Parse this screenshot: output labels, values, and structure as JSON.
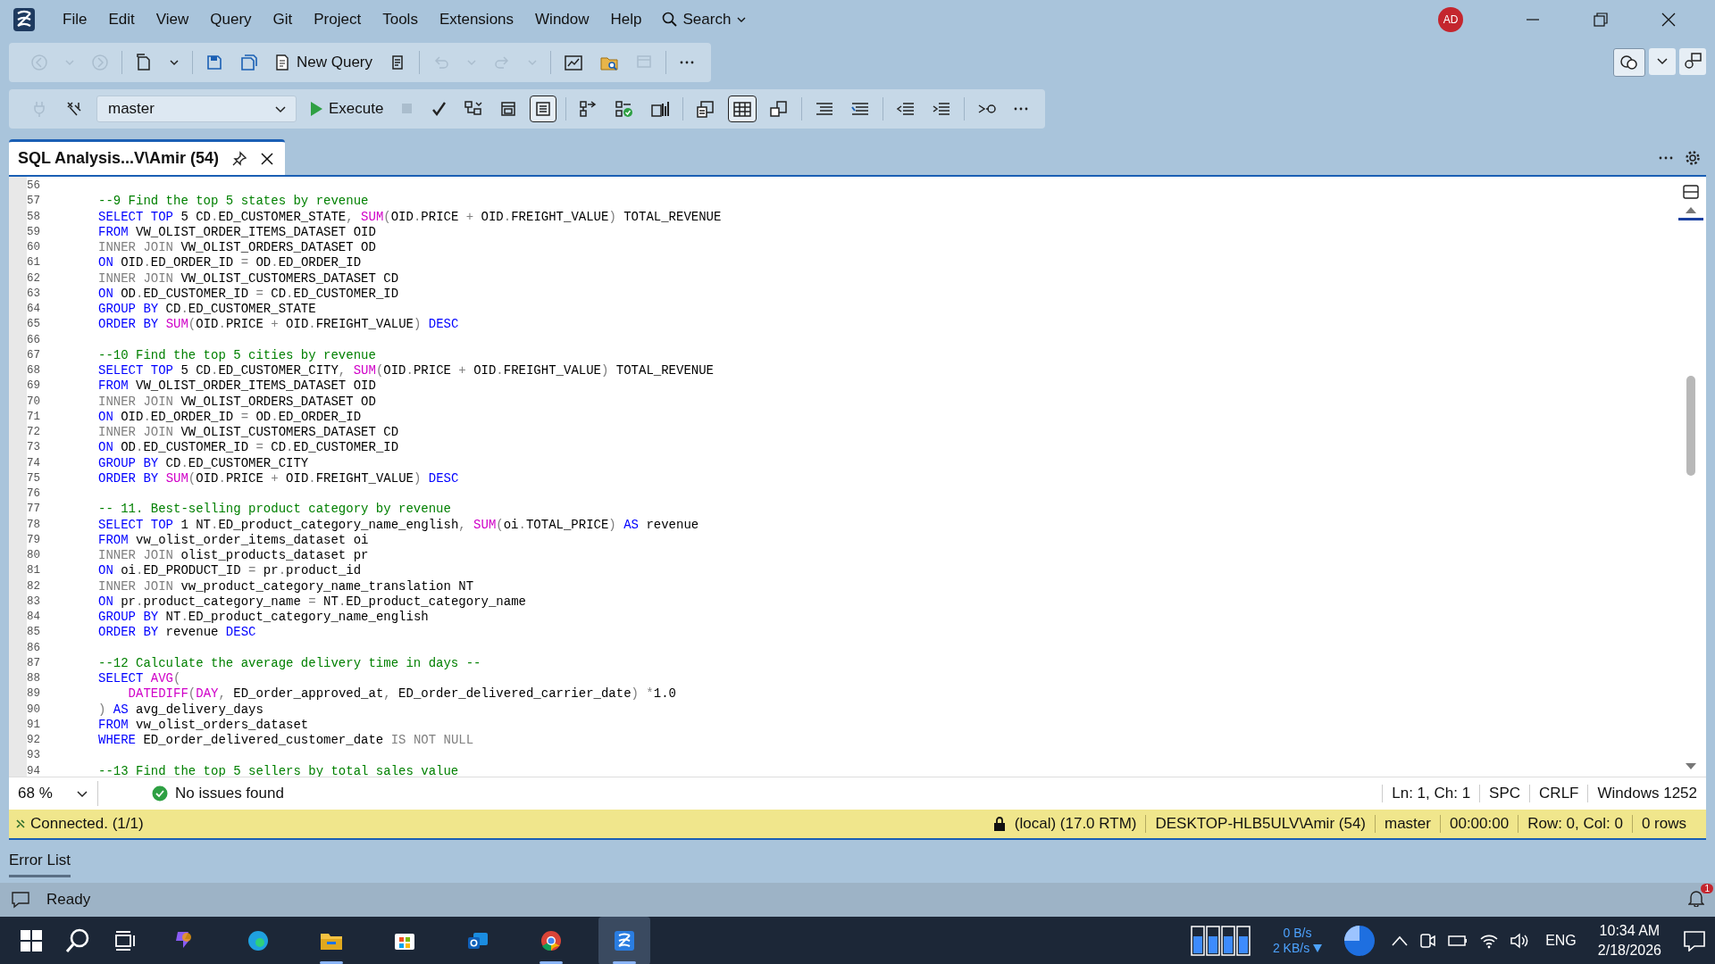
{
  "menu": [
    "File",
    "Edit",
    "View",
    "Query",
    "Git",
    "Project",
    "Tools",
    "Extensions",
    "Window",
    "Help"
  ],
  "search": "Search",
  "avatar": "AD",
  "toolbar_1": {
    "buttons_before": [
      {
        "disabled": true
      },
      {
        "disabled": true
      },
      {
        "disabled": true
      },
      {
        "disabled": false
      },
      {
        "disabled": false
      },
      {
        "disabled": false
      },
      {
        "disabled": false
      }
    ],
    "new_query": "New Query",
    "buttons_after": [
      {
        "disabled": false
      },
      {
        "disabled": true
      },
      {
        "disabled": true
      },
      {
        "disabled": true
      },
      {
        "disabled": true
      },
      {
        "disabled": false
      },
      {
        "disabled": false
      },
      {
        "disabled": true
      },
      {
        "disabled": false
      }
    ]
  },
  "toolbar_2": {
    "buttons_before": [
      {
        "disabled": true
      },
      {
        "disabled": false
      }
    ],
    "database": "master",
    "execute": "Execute",
    "buttons_after": [
      {
        "disabled": true,
        "selected": false
      },
      {
        "disabled": false,
        "selected": false
      },
      {
        "disabled": false,
        "selected": false
      },
      {
        "disabled": false,
        "selected": false
      },
      {
        "disabled": false,
        "selected": true
      },
      {
        "disabled": false,
        "selected": false
      },
      {
        "disabled": false,
        "selected": false
      },
      {
        "disabled": false,
        "selected": false
      },
      {
        "disabled": false,
        "selected": false
      },
      {
        "disabled": false,
        "selected": true
      },
      {
        "disabled": false,
        "selected": false
      },
      {
        "disabled": false,
        "selected": false
      },
      {
        "disabled": false,
        "selected": false
      },
      {
        "disabled": false,
        "selected": false
      },
      {
        "disabled": false,
        "selected": false
      },
      {
        "disabled": false,
        "selected": false
      },
      {
        "disabled": false,
        "selected": false
      }
    ]
  },
  "tab": {
    "title": "SQL Analysis...V\\Amir (54)",
    "selected": true
  },
  "lines": [
    {
      "n": "56"
    },
    {
      "n": "57",
      "t": [
        {
          "kind": "comment",
          "text": "--9 Find the top 5 states by revenue"
        }
      ]
    },
    {
      "n": "58",
      "t": [
        {
          "kind": "keyword",
          "text": "SELECT TOP"
        },
        {
          "kind": "plain",
          "text": " 5 CD"
        },
        {
          "kind": "gray",
          "text": "."
        },
        {
          "kind": "plain",
          "text": "ED_CUSTOMER_STATE"
        },
        {
          "kind": "gray",
          "text": ", "
        },
        {
          "kind": "function",
          "text": "SUM"
        },
        {
          "kind": "gray",
          "text": "("
        },
        {
          "kind": "plain",
          "text": "OID"
        },
        {
          "kind": "gray",
          "text": "."
        },
        {
          "kind": "plain",
          "text": "PRICE "
        },
        {
          "kind": "gray",
          "text": "+"
        },
        {
          "kind": "plain",
          "text": " OID"
        },
        {
          "kind": "gray",
          "text": "."
        },
        {
          "kind": "plain",
          "text": "FREIGHT_VALUE"
        },
        {
          "kind": "gray",
          "text": ")"
        },
        {
          "kind": "plain",
          "text": " TOTAL_REVENUE"
        }
      ]
    },
    {
      "n": "59",
      "t": [
        {
          "kind": "keyword",
          "text": "FROM"
        },
        {
          "kind": "plain",
          "text": " VW_OLIST_ORDER_ITEMS_DATASET OID"
        }
      ]
    },
    {
      "n": "60",
      "t": [
        {
          "kind": "gray",
          "text": "INNER JOIN"
        },
        {
          "kind": "plain",
          "text": " VW_OLIST_ORDERS_DATASET OD"
        }
      ]
    },
    {
      "n": "61",
      "t": [
        {
          "kind": "keyword",
          "text": "ON"
        },
        {
          "kind": "plain",
          "text": " OID"
        },
        {
          "kind": "gray",
          "text": "."
        },
        {
          "kind": "plain",
          "text": "ED_ORDER_ID "
        },
        {
          "kind": "gray",
          "text": "="
        },
        {
          "kind": "plain",
          "text": " OD"
        },
        {
          "kind": "gray",
          "text": "."
        },
        {
          "kind": "plain",
          "text": "ED_ORDER_ID"
        }
      ]
    },
    {
      "n": "62",
      "t": [
        {
          "kind": "gray",
          "text": "INNER JOIN"
        },
        {
          "kind": "plain",
          "text": " VW_OLIST_CUSTOMERS_DATASET CD"
        }
      ]
    },
    {
      "n": "63",
      "t": [
        {
          "kind": "keyword",
          "text": "ON"
        },
        {
          "kind": "plain",
          "text": " OD"
        },
        {
          "kind": "gray",
          "text": "."
        },
        {
          "kind": "plain",
          "text": "ED_CUSTOMER_ID "
        },
        {
          "kind": "gray",
          "text": "="
        },
        {
          "kind": "plain",
          "text": " CD"
        },
        {
          "kind": "gray",
          "text": "."
        },
        {
          "kind": "plain",
          "text": "ED_CUSTOMER_ID"
        }
      ]
    },
    {
      "n": "64",
      "t": [
        {
          "kind": "keyword",
          "text": "GROUP BY"
        },
        {
          "kind": "plain",
          "text": " CD"
        },
        {
          "kind": "gray",
          "text": "."
        },
        {
          "kind": "plain",
          "text": "ED_CUSTOMER_STATE"
        }
      ]
    },
    {
      "n": "65",
      "t": [
        {
          "kind": "keyword",
          "text": "ORDER BY "
        },
        {
          "kind": "function",
          "text": "SUM"
        },
        {
          "kind": "gray",
          "text": "("
        },
        {
          "kind": "plain",
          "text": "OID"
        },
        {
          "kind": "gray",
          "text": "."
        },
        {
          "kind": "plain",
          "text": "PRICE "
        },
        {
          "kind": "gray",
          "text": "+"
        },
        {
          "kind": "plain",
          "text": " OID"
        },
        {
          "kind": "gray",
          "text": "."
        },
        {
          "kind": "plain",
          "text": "FREIGHT_VALUE"
        },
        {
          "kind": "gray",
          "text": ") "
        },
        {
          "kind": "keyword",
          "text": "DESC"
        }
      ]
    },
    {
      "n": "66"
    },
    {
      "n": "67",
      "t": [
        {
          "kind": "comment",
          "text": "--10 Find the top 5 cities by revenue"
        }
      ]
    },
    {
      "n": "68",
      "t": [
        {
          "kind": "keyword",
          "text": "SELECT TOP"
        },
        {
          "kind": "plain",
          "text": " 5 CD"
        },
        {
          "kind": "gray",
          "text": "."
        },
        {
          "kind": "plain",
          "text": "ED_CUSTOMER_CITY"
        },
        {
          "kind": "gray",
          "text": ", "
        },
        {
          "kind": "function",
          "text": "SUM"
        },
        {
          "kind": "gray",
          "text": "("
        },
        {
          "kind": "plain",
          "text": "OID"
        },
        {
          "kind": "gray",
          "text": "."
        },
        {
          "kind": "plain",
          "text": "PRICE "
        },
        {
          "kind": "gray",
          "text": "+"
        },
        {
          "kind": "plain",
          "text": " OID"
        },
        {
          "kind": "gray",
          "text": "."
        },
        {
          "kind": "plain",
          "text": "FREIGHT_VALUE"
        },
        {
          "kind": "gray",
          "text": ")"
        },
        {
          "kind": "plain",
          "text": " TOTAL_REVENUE"
        }
      ]
    },
    {
      "n": "69",
      "t": [
        {
          "kind": "keyword",
          "text": "FROM"
        },
        {
          "kind": "plain",
          "text": " VW_OLIST_ORDER_ITEMS_DATASET OID"
        }
      ]
    },
    {
      "n": "70",
      "t": [
        {
          "kind": "gray",
          "text": "INNER JOIN"
        },
        {
          "kind": "plain",
          "text": " VW_OLIST_ORDERS_DATASET OD"
        }
      ]
    },
    {
      "n": "71",
      "t": [
        {
          "kind": "keyword",
          "text": "ON"
        },
        {
          "kind": "plain",
          "text": " OID"
        },
        {
          "kind": "gray",
          "text": "."
        },
        {
          "kind": "plain",
          "text": "ED_ORDER_ID "
        },
        {
          "kind": "gray",
          "text": "="
        },
        {
          "kind": "plain",
          "text": " OD"
        },
        {
          "kind": "gray",
          "text": "."
        },
        {
          "kind": "plain",
          "text": "ED_ORDER_ID"
        }
      ]
    },
    {
      "n": "72",
      "t": [
        {
          "kind": "gray",
          "text": "INNER JOIN"
        },
        {
          "kind": "plain",
          "text": " VW_OLIST_CUSTOMERS_DATASET CD"
        }
      ]
    },
    {
      "n": "73",
      "t": [
        {
          "kind": "keyword",
          "text": "ON"
        },
        {
          "kind": "plain",
          "text": " OD"
        },
        {
          "kind": "gray",
          "text": "."
        },
        {
          "kind": "plain",
          "text": "ED_CUSTOMER_ID "
        },
        {
          "kind": "gray",
          "text": "="
        },
        {
          "kind": "plain",
          "text": " CD"
        },
        {
          "kind": "gray",
          "text": "."
        },
        {
          "kind": "plain",
          "text": "ED_CUSTOMER_ID"
        }
      ]
    },
    {
      "n": "74",
      "t": [
        {
          "kind": "keyword",
          "text": "GROUP BY"
        },
        {
          "kind": "plain",
          "text": " CD"
        },
        {
          "kind": "gray",
          "text": "."
        },
        {
          "kind": "plain",
          "text": "ED_CUSTOMER_CITY"
        }
      ]
    },
    {
      "n": "75",
      "t": [
        {
          "kind": "keyword",
          "text": "ORDER BY "
        },
        {
          "kind": "function",
          "text": "SUM"
        },
        {
          "kind": "gray",
          "text": "("
        },
        {
          "kind": "plain",
          "text": "OID"
        },
        {
          "kind": "gray",
          "text": "."
        },
        {
          "kind": "plain",
          "text": "PRICE "
        },
        {
          "kind": "gray",
          "text": "+"
        },
        {
          "kind": "plain",
          "text": " OID"
        },
        {
          "kind": "gray",
          "text": "."
        },
        {
          "kind": "plain",
          "text": "FREIGHT_VALUE"
        },
        {
          "kind": "gray",
          "text": ") "
        },
        {
          "kind": "keyword",
          "text": "DESC"
        }
      ]
    },
    {
      "n": "76"
    },
    {
      "n": "77",
      "t": [
        {
          "kind": "comment",
          "text": "-- 11. Best-selling product category by revenue"
        }
      ]
    },
    {
      "n": "78",
      "t": [
        {
          "kind": "keyword",
          "text": "SELECT TOP"
        },
        {
          "kind": "plain",
          "text": " 1 NT"
        },
        {
          "kind": "gray",
          "text": "."
        },
        {
          "kind": "plain",
          "text": "ED_product_category_name_english"
        },
        {
          "kind": "gray",
          "text": ", "
        },
        {
          "kind": "function",
          "text": "SUM"
        },
        {
          "kind": "gray",
          "text": "("
        },
        {
          "kind": "plain",
          "text": "oi"
        },
        {
          "kind": "gray",
          "text": "."
        },
        {
          "kind": "plain",
          "text": "TOTAL_PRICE"
        },
        {
          "kind": "gray",
          "text": ") "
        },
        {
          "kind": "keyword",
          "text": "AS"
        },
        {
          "kind": "plain",
          "text": " revenue"
        }
      ]
    },
    {
      "n": "79",
      "t": [
        {
          "kind": "keyword",
          "text": "FROM"
        },
        {
          "kind": "plain",
          "text": " vw_olist_order_items_dataset oi"
        }
      ]
    },
    {
      "n": "80",
      "t": [
        {
          "kind": "gray",
          "text": "INNER JOIN"
        },
        {
          "kind": "plain",
          "text": " olist_products_dataset pr"
        }
      ]
    },
    {
      "n": "81",
      "t": [
        {
          "kind": "keyword",
          "text": "ON"
        },
        {
          "kind": "plain",
          "text": " oi"
        },
        {
          "kind": "gray",
          "text": "."
        },
        {
          "kind": "plain",
          "text": "ED_PRODUCT_ID "
        },
        {
          "kind": "gray",
          "text": "="
        },
        {
          "kind": "plain",
          "text": " pr"
        },
        {
          "kind": "gray",
          "text": "."
        },
        {
          "kind": "plain",
          "text": "product_id"
        }
      ]
    },
    {
      "n": "82",
      "t": [
        {
          "kind": "gray",
          "text": "INNER JOIN"
        },
        {
          "kind": "plain",
          "text": " vw_product_category_name_translation NT"
        }
      ]
    },
    {
      "n": "83",
      "t": [
        {
          "kind": "keyword",
          "text": "ON"
        },
        {
          "kind": "plain",
          "text": " pr"
        },
        {
          "kind": "gray",
          "text": "."
        },
        {
          "kind": "plain",
          "text": "product_category_name "
        },
        {
          "kind": "gray",
          "text": "="
        },
        {
          "kind": "plain",
          "text": " NT"
        },
        {
          "kind": "gray",
          "text": "."
        },
        {
          "kind": "plain",
          "text": "ED_product_category_name"
        }
      ]
    },
    {
      "n": "84",
      "t": [
        {
          "kind": "keyword",
          "text": "GROUP BY"
        },
        {
          "kind": "plain",
          "text": " NT"
        },
        {
          "kind": "gray",
          "text": "."
        },
        {
          "kind": "plain",
          "text": "ED_product_category_name_english"
        }
      ]
    },
    {
      "n": "85",
      "t": [
        {
          "kind": "keyword",
          "text": "ORDER BY"
        },
        {
          "kind": "plain",
          "text": " revenue "
        },
        {
          "kind": "keyword",
          "text": "DESC"
        }
      ]
    },
    {
      "n": "86"
    },
    {
      "n": "87",
      "t": [
        {
          "kind": "comment",
          "text": "--12 Calculate the average delivery time in days --"
        }
      ]
    },
    {
      "n": "88",
      "t": [
        {
          "kind": "keyword",
          "text": "SELECT "
        },
        {
          "kind": "function",
          "text": "AVG"
        },
        {
          "kind": "gray",
          "text": "("
        }
      ]
    },
    {
      "n": "89",
      "t": [
        {
          "kind": "function",
          "text": "    DATEDIFF"
        },
        {
          "kind": "gray",
          "text": "("
        },
        {
          "kind": "function",
          "text": "DAY"
        },
        {
          "kind": "gray",
          "text": ", "
        },
        {
          "kind": "plain",
          "text": "ED_order_approved_at"
        },
        {
          "kind": "gray",
          "text": ", "
        },
        {
          "kind": "plain",
          "text": "ED_order_delivered_carrier_date"
        },
        {
          "kind": "gray",
          "text": ") *"
        },
        {
          "kind": "plain",
          "text": "1.0"
        }
      ]
    },
    {
      "n": "90",
      "t": [
        {
          "kind": "gray",
          "text": ") "
        },
        {
          "kind": "keyword",
          "text": "AS"
        },
        {
          "kind": "plain",
          "text": " avg_delivery_days"
        }
      ]
    },
    {
      "n": "91",
      "t": [
        {
          "kind": "keyword",
          "text": "FROM"
        },
        {
          "kind": "plain",
          "text": " vw_olist_orders_dataset"
        }
      ]
    },
    {
      "n": "92",
      "t": [
        {
          "kind": "keyword",
          "text": "WHERE"
        },
        {
          "kind": "plain",
          "text": " ED_order_delivered_customer_date "
        },
        {
          "kind": "gray",
          "text": "IS NOT NULL"
        }
      ]
    },
    {
      "n": "93"
    },
    {
      "n": "94",
      "t": [
        {
          "kind": "comment",
          "text": "--13 Find the top 5 sellers by total sales value"
        }
      ]
    }
  ],
  "editor_footer": {
    "zoom": "68 %",
    "issues": "No issues found",
    "position": "Ln: 1, Ch: 1",
    "indent": "SPC",
    "line_endings": "CRLF",
    "encoding": "Windows 1252"
  },
  "connection_bar": {
    "status": "Connected. (1/1)",
    "server": "(local) (17.0 RTM)",
    "login": "DESKTOP-HLB5ULV\\Amir (54)",
    "database": "master",
    "elapsed": "00:00:00",
    "cursor": "Row: 0, Col: 0",
    "rows": "0 rows"
  },
  "bottom_tab": {
    "label": "Error List",
    "selected": true
  },
  "status_bar": {
    "text": "Ready",
    "notifications": "1"
  },
  "taskbar": {
    "apps": [
      {
        "running": false,
        "selected": false
      },
      {
        "running": false,
        "selected": false
      },
      {
        "running": true,
        "selected": false
      },
      {
        "running": false,
        "selected": false
      },
      {
        "running": false,
        "selected": false
      },
      {
        "running": true,
        "selected": false
      },
      {
        "running": true,
        "selected": true
      }
    ],
    "upload": "0 B/s",
    "download": "2 KB/s",
    "language": "ENG",
    "time": "10:34 AM",
    "date": "2/18/2026"
  }
}
